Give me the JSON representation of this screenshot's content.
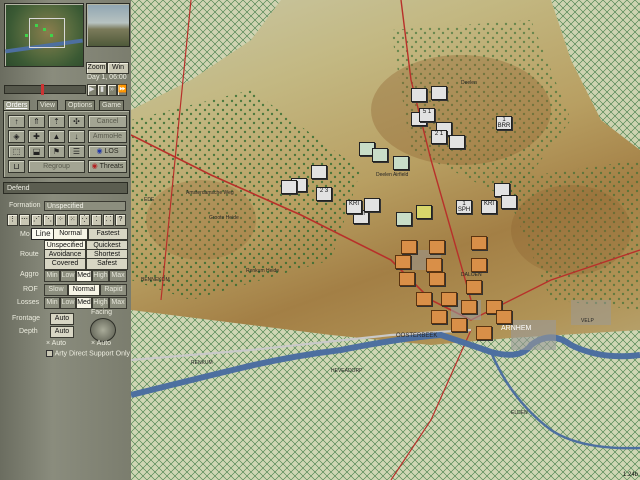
{
  "top": {
    "zoom_label": "Zoom",
    "win_label": "Win",
    "day_time": "Day 1, 06:00"
  },
  "tabs": [
    {
      "label": "Orders"
    },
    {
      "label": "View"
    },
    {
      "label": "Options"
    },
    {
      "label": "Game"
    }
  ],
  "orders": {
    "cancel_label": "Cancel",
    "ammo_label": "AmmoHe",
    "los_label": "LOS",
    "threats_label": "Threats",
    "regroup_label": "Regroup"
  },
  "mode": "Defend",
  "formation": {
    "label": "Formation",
    "value": "Unspecified"
  },
  "move": {
    "label": "Mo",
    "line_tooltip": "Line",
    "options": [
      "Normal",
      "Fastest"
    ]
  },
  "route": {
    "label": "Route",
    "options": [
      "Unspecified",
      "Quickest",
      "Avoidance",
      "Shortest",
      "Covered",
      "Safest"
    ]
  },
  "aggro": {
    "label": "Aggro",
    "options": [
      "Min",
      "Low",
      "Med",
      "High",
      "Max"
    ],
    "selected": "Med"
  },
  "rof": {
    "label": "ROF",
    "options": [
      "Slow",
      "Normal",
      "Rapid"
    ],
    "selected": "Normal"
  },
  "losses": {
    "label": "Losses",
    "options": [
      "Min",
      "Low",
      "Med",
      "High",
      "Max"
    ],
    "selected": "Med"
  },
  "frontage": {
    "label": "Frontage",
    "value": "Auto",
    "check": "Auto"
  },
  "facing": {
    "label": "Facing",
    "check": "Auto"
  },
  "depth": {
    "label": "Depth",
    "value": "Auto"
  },
  "arty": "Arty Direct Support Only",
  "map": {
    "places": [
      "Amsterdamsche Weg",
      "Groote Heide",
      "Deelen Airfield",
      "Deelen",
      "OOSTERBEEK",
      "ARNHEM",
      "VELP",
      "BENNEKOM",
      "Renkum Heide",
      "RENKUM",
      "HEVEADORP",
      "ELDEN",
      "DALOEN",
      "EDE"
    ],
    "units": [
      {
        "label": "1 BRR"
      },
      {
        "label": "5 1"
      },
      {
        "label": "2 1"
      },
      {
        "label": "KRF"
      },
      {
        "label": "KRI"
      },
      {
        "label": "1 SPH"
      },
      {
        "label": "KRI"
      },
      {
        "label": "2 3"
      }
    ],
    "version": "1.24b"
  },
  "colors": {
    "panel": "#7b7d6e",
    "allied_unit": "#d98f48",
    "axis_unit": "#e2e2e2",
    "river": "#4d6fa0",
    "road": "#b8302a"
  }
}
